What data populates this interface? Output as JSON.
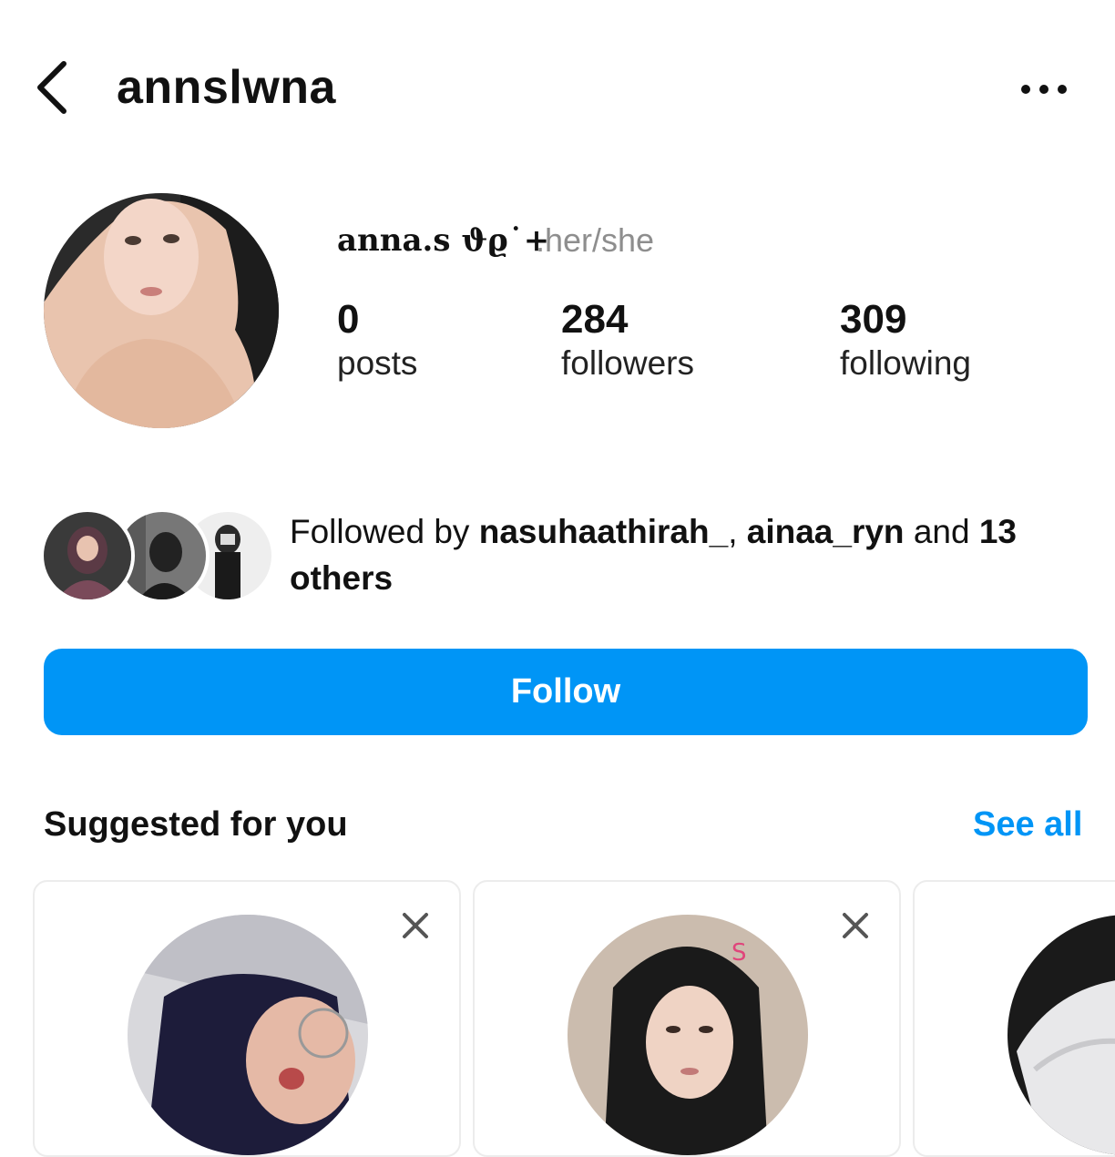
{
  "header": {
    "username": "annslwna",
    "back_icon": "chevron-left-icon",
    "more_icon": "ellipsis-icon"
  },
  "profile": {
    "display_name": "anna.s ϑϱ˙+",
    "pronouns": ".her/she",
    "stats": [
      {
        "value": "0",
        "label": "posts"
      },
      {
        "value": "284",
        "label": "followers"
      },
      {
        "value": "309",
        "label": "following"
      }
    ]
  },
  "followed_by": {
    "prefix": "Followed by ",
    "user1": "nasuhaathirah_",
    "sep": ", ",
    "user2": "ainaa_ryn",
    "and": " and ",
    "others": "13 others"
  },
  "follow_button": {
    "label": "Follow"
  },
  "suggested": {
    "title": "Suggested for you",
    "see_all": "See all"
  },
  "colors": {
    "accent": "#0095f6",
    "muted_text": "#8e8e8e"
  }
}
